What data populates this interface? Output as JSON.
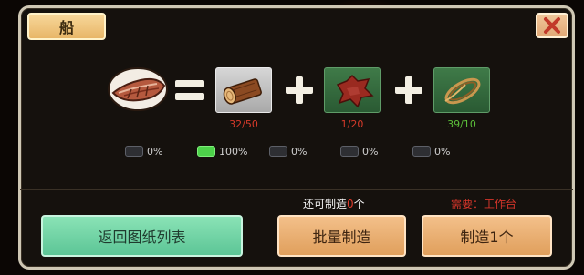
{
  "window": {
    "title": "船"
  },
  "recipe": {
    "result": {
      "icon": "boat-icon"
    },
    "ingredients": [
      {
        "icon": "wood-log-icon",
        "count": "32/50",
        "status": "insufficient",
        "status_color": "#d63a2a"
      },
      {
        "icon": "leather-hide-icon",
        "count": "1/20",
        "status": "insufficient",
        "status_color": "#d63a2a"
      },
      {
        "icon": "rope-coil-icon",
        "count": "39/10",
        "status": "sufficient",
        "status_color": "#5cbf3a"
      }
    ]
  },
  "chances": [
    {
      "label": "0%",
      "active": false
    },
    {
      "label": "100%",
      "active": true
    },
    {
      "label": "0%",
      "active": false
    },
    {
      "label": "0%",
      "active": false
    },
    {
      "label": "0%",
      "active": false
    }
  ],
  "craft_info": {
    "can_make_prefix": "还可制造",
    "can_make_count": "0",
    "can_make_suffix": "个",
    "requirement": "需要：工作台"
  },
  "buttons": {
    "back": "返回图纸列表",
    "batch": "批量制造",
    "one": "制造1个"
  },
  "colors": {
    "accent_green_button": "#5cc596",
    "accent_orange_button": "#e09f5c",
    "insufficient": "#d63a2a",
    "sufficient": "#5cbf3a"
  }
}
